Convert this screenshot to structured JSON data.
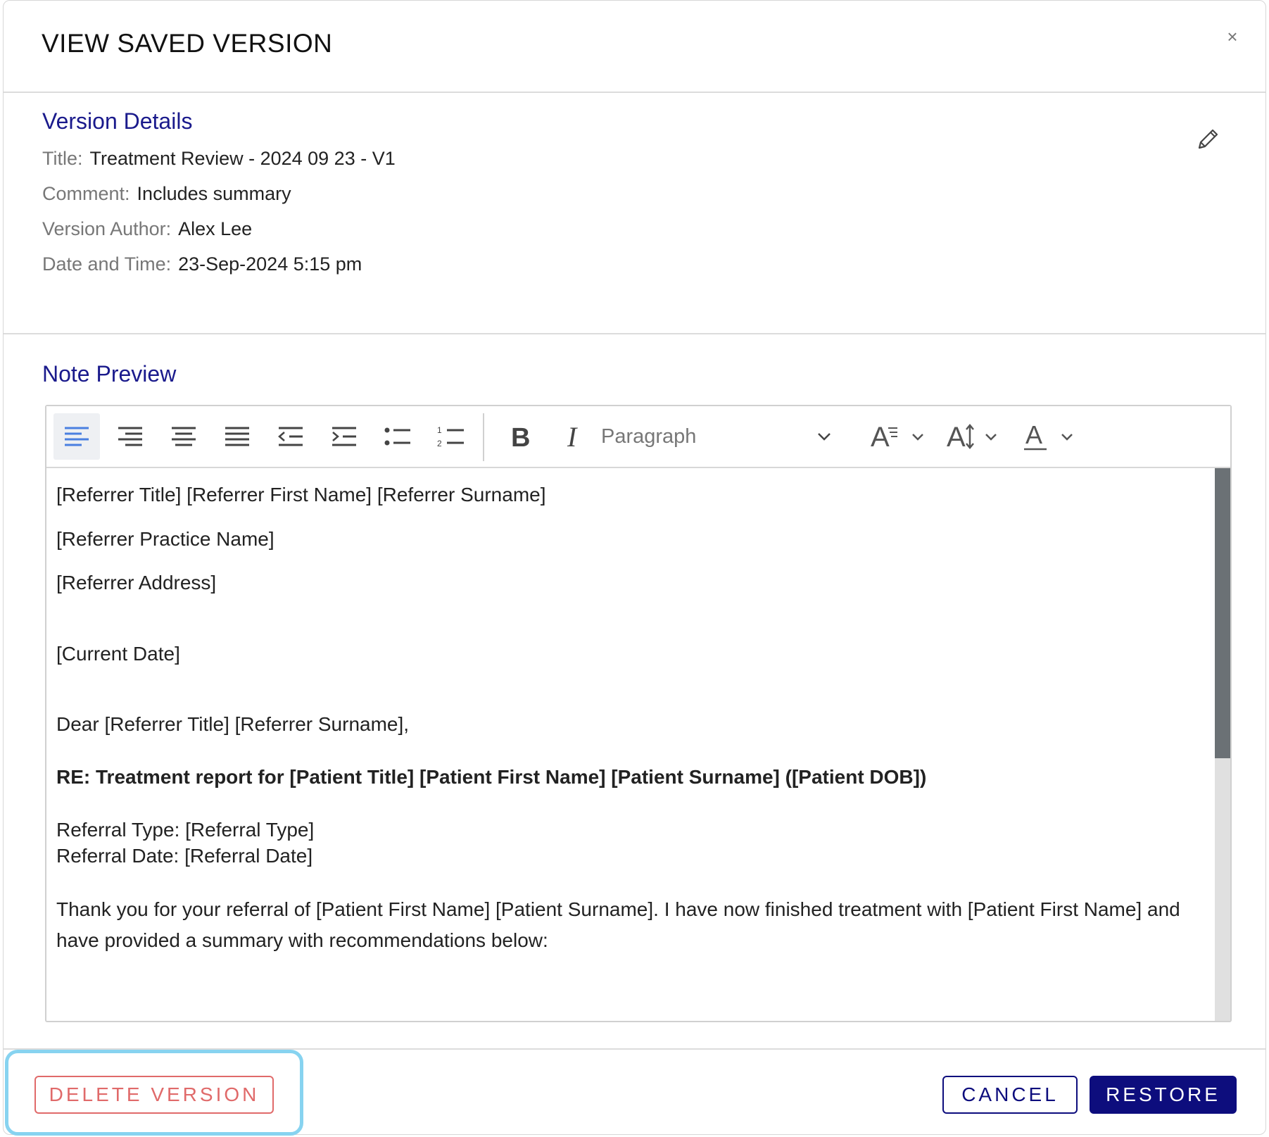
{
  "dialog": {
    "title": "VIEW SAVED VERSION",
    "close_glyph": "×"
  },
  "details": {
    "heading": "Version Details",
    "rows": [
      {
        "label": "Title:",
        "value": "Treatment Review - 2024 09 23 - V1"
      },
      {
        "label": "Comment:",
        "value": "Includes summary"
      },
      {
        "label": "Version Author:",
        "value": "Alex Lee"
      },
      {
        "label": "Date and Time:",
        "value": "23-Sep-2024 5:15 pm"
      }
    ]
  },
  "preview": {
    "heading": "Note Preview",
    "toolbar": {
      "paragraph_select": "Paragraph",
      "icons": [
        "align-left-icon",
        "align-right-icon",
        "align-center-icon",
        "align-justify-icon",
        "outdent-icon",
        "indent-icon",
        "bulleted-list-icon",
        "numbered-list-icon",
        "bold-icon",
        "italic-icon",
        "chevron-down-icon",
        "font-size-icon",
        "line-height-icon",
        "font-color-icon"
      ]
    },
    "lines": [
      "[Referrer Title] [Referrer First Name] [Referrer Surname]",
      "[Referrer Practice Name]",
      "[Referrer Address]",
      "[Current Date]",
      "Dear [Referrer Title] [Referrer Surname],",
      "RE: Treatment report for [Patient Title] [Patient First Name] [Patient Surname] ([Patient DOB])",
      "Referral Type: [Referral Type]",
      "Referral Date: [Referral Date]",
      "Thank you for your referral of [Patient First Name] [Patient Surname]. I have now finished treatment with [Patient First Name] and have provided a summary with recommendations below:"
    ]
  },
  "footer": {
    "delete_label": "DELETE VERSION",
    "cancel_label": "CANCEL",
    "restore_label": "RESTORE"
  },
  "colors": {
    "accent": "#0d0d7d",
    "heading": "#1a1a8c",
    "danger": "#e06a6a",
    "highlight": "#87d3f0"
  }
}
